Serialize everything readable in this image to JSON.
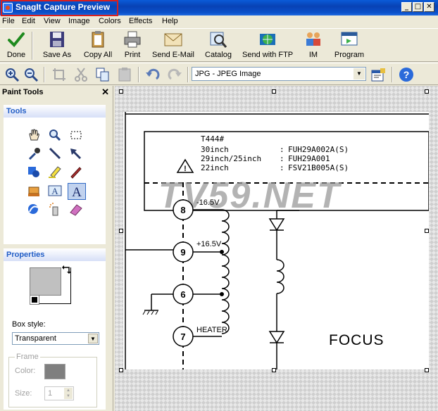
{
  "window": {
    "title": "SnagIt Capture Preview",
    "minimize_glyph": "_",
    "maximize_glyph": "□",
    "close_glyph": "✕"
  },
  "menu": [
    "File",
    "Edit",
    "View",
    "Image",
    "Colors",
    "Effects",
    "Help"
  ],
  "toolbar": {
    "done": "Done",
    "save_as": "Save As",
    "copy_all": "Copy All",
    "print": "Print",
    "send_email": "Send E-Mail",
    "catalog": "Catalog",
    "send_ftp": "Send with FTP",
    "im": "IM",
    "program": "Program"
  },
  "format": {
    "selected": "JPG - JPEG Image"
  },
  "left_panel": {
    "title": "Paint Tools",
    "close_glyph": "✕",
    "tools_heading": "Tools",
    "text_tool_glyph": "A",
    "stamp_tool_glyph": "A",
    "properties_heading": "Properties",
    "box_style_label": "Box style:",
    "box_style_value": "Transparent",
    "frame_label": "Frame",
    "color_label": "Color:",
    "size_label": "Size:",
    "size_value": "1"
  },
  "schematic": {
    "model": "T444#",
    "row1_size": "30inch",
    "row1_code": "FUH29A002A(S)",
    "row2_size": "29inch/25inch",
    "row2_code": "FUH29A001",
    "row3_size": "22inch",
    "row3_code": "FSV21B005A(S)",
    "colon": ":",
    "warning_glyph": "!",
    "watermark": "TV59.NET",
    "pin8": "8",
    "pin9": "9",
    "pin6": "6",
    "pin7": "7",
    "v1": "-16.5V",
    "v2": "+16.5V",
    "heater": "HEATER",
    "focus": "FOCUS"
  },
  "colors": {
    "accent": "#215DC6",
    "title_highlight": "#D62020",
    "frame_color": "#7F7F7F"
  }
}
